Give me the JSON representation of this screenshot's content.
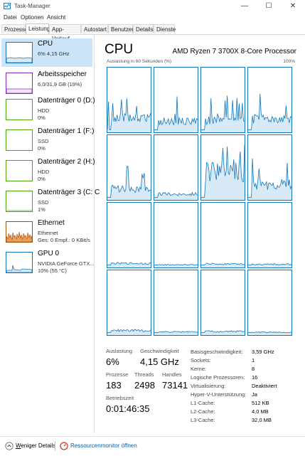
{
  "window": {
    "title": "Task-Manager",
    "controls": {
      "minimize": "—",
      "maximize": "☐",
      "close": "✕"
    }
  },
  "menu": {
    "items": [
      "Datei",
      "Optionen",
      "Ansicht"
    ]
  },
  "tabs": [
    "Prozesse",
    "Leistung",
    "App-Verlauf",
    "Autostart",
    "Benutzer",
    "Details",
    "Dienste"
  ],
  "active_tab": "Leistung",
  "sidebar": {
    "items": [
      {
        "name": "CPU",
        "line1": "6% 4,15 GHz",
        "line2": "",
        "color": "#1177bb",
        "selected": true
      },
      {
        "name": "Arbeitsspeicher",
        "line1": "6,0/31,9 GB (19%)",
        "line2": "",
        "color": "#8e2bbd"
      },
      {
        "name": "Datenträger 0 (D:)",
        "line1": "HDD",
        "line2": "0%",
        "color": "#4da60c"
      },
      {
        "name": "Datenträger 1 (F:)",
        "line1": "SSD",
        "line2": "0%",
        "color": "#4da60c"
      },
      {
        "name": "Datenträger 2 (H:)",
        "line1": "HDD",
        "line2": "0%",
        "color": "#4da60c"
      },
      {
        "name": "Datenträger 3 (C: C",
        "line1": "SSD",
        "line2": "1%",
        "color": "#4da60c"
      },
      {
        "name": "Ethernet",
        "line1": "Ethernet",
        "line2": "Ges: 0 Empf.: 0 KBit/s",
        "color": "#a74f01"
      },
      {
        "name": "GPU 0",
        "line1": "NVIDIA GeForce GTX...",
        "line2": "10% (55 °C)",
        "color": "#1177bb"
      }
    ]
  },
  "main": {
    "title": "CPU",
    "model": "AMD Ryzen 7 3700X 8-Core Processor",
    "graph_label_left": "Auslastung in 60 Sekunden (%)",
    "graph_label_right": "100%",
    "graph_color": "#1177bb",
    "graph_fill": "#d9eaf7"
  },
  "stats": {
    "auslastung_label": "Auslastung",
    "auslastung": "6%",
    "geschw_label": "Geschwindigkeit",
    "geschw": "4,15 GHz",
    "prozesse_label": "Prozesse",
    "prozesse": "183",
    "threads_label": "Threads",
    "threads": "2498",
    "handles_label": "Handles",
    "handles": "73141",
    "betriebszeit_label": "Betriebszeit",
    "betriebszeit": "0:01:46:35"
  },
  "details": [
    {
      "key": "Basisgeschwindigkeit:",
      "value": "3,59 GHz"
    },
    {
      "key": "Sockets:",
      "value": "1"
    },
    {
      "key": "Kerne:",
      "value": "8"
    },
    {
      "key": "Logische Prozessoren:",
      "value": "16"
    },
    {
      "key": "Virtualisierung:",
      "value": "Deaktiviert"
    },
    {
      "key": "Hyper-V-Unterstützung:",
      "value": "Ja"
    },
    {
      "key": "L1-Cache:",
      "value": "512 KB"
    },
    {
      "key": "L2-Cache:",
      "value": "4,0 MB"
    },
    {
      "key": "L3-Cache:",
      "value": "32,0 MB"
    }
  ],
  "footer": {
    "fewer_details_prefix": "W",
    "fewer_details": "eniger Details",
    "resource_monitor": "Ressourcenmonitor öffnen"
  }
}
